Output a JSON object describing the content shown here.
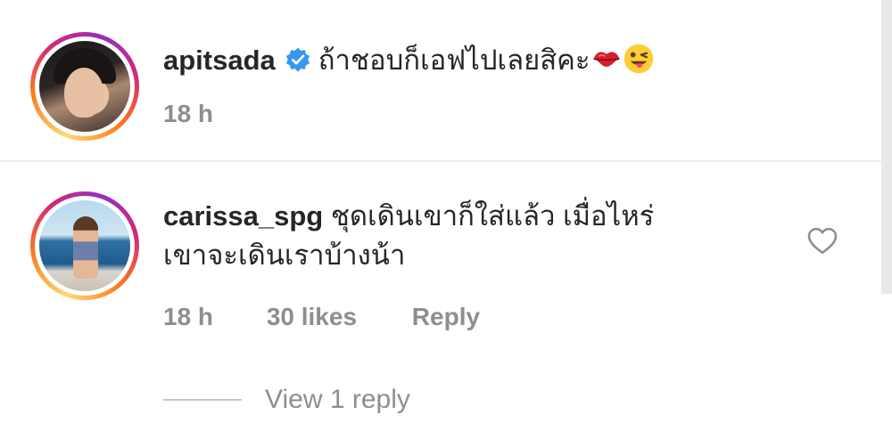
{
  "comments": [
    {
      "username": "apitsada",
      "verified": true,
      "text": "ถ้าชอบก็เอฟไปเลยสิคะ",
      "emojis": [
        "kiss-mark-emoji",
        "winking-tongue-emoji"
      ],
      "time": "18 h"
    },
    {
      "username": "carissa_spg",
      "text_line1": "ชุดเดินเขาก็ใส่แล้ว เมื่อไหร่",
      "text_line2": "เขาจะเดินเราบ้างน้า",
      "time": "18 h",
      "likes": "30 likes",
      "reply_label": "Reply",
      "view_replies": "View 1 reply",
      "like_icon": "heart-outline-icon"
    }
  ],
  "colors": {
    "text": "#262626",
    "meta": "#8e8e8e",
    "verified": "#3897f0",
    "divider": "#efefef"
  }
}
